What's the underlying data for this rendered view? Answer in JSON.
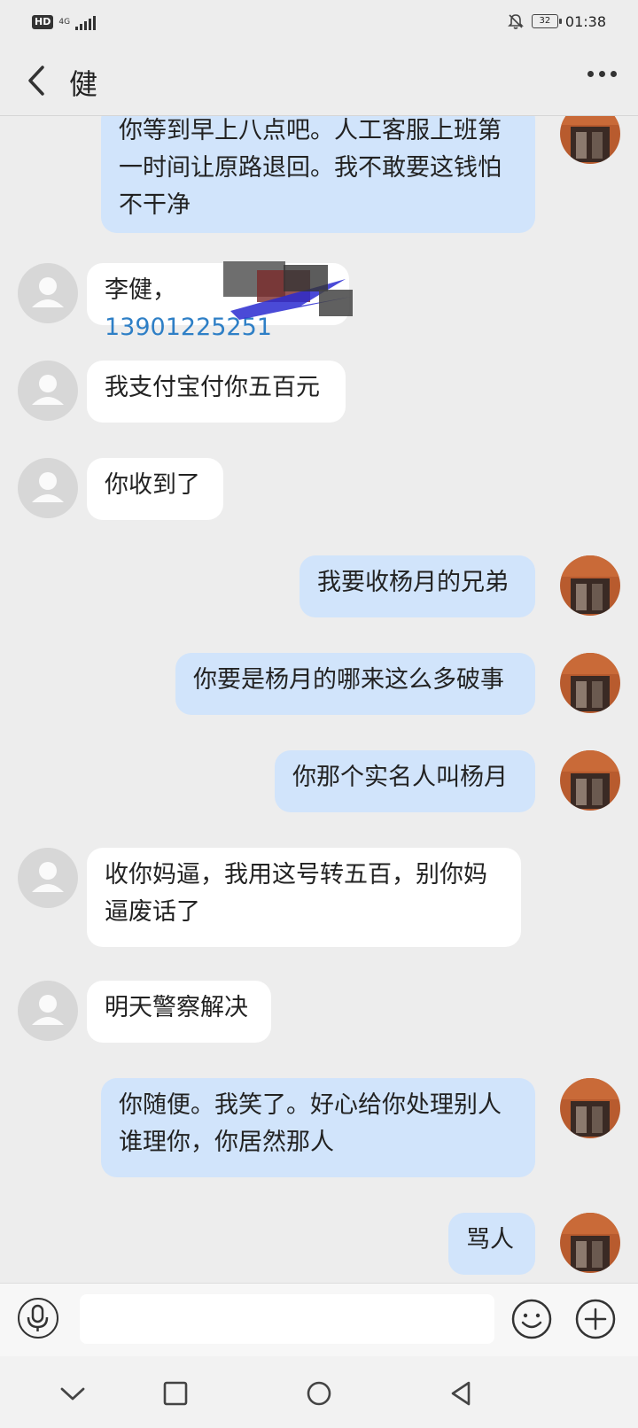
{
  "status_bar": {
    "hd_badge": "HD",
    "network": "4G",
    "battery_level": "32",
    "time": "01:38"
  },
  "header": {
    "contact_name": "健",
    "back_icon": "chevron-left-icon",
    "more_icon": "more-horizontal-icon"
  },
  "messages": [
    {
      "side": "out",
      "text": "你等到早上八点吧。人工客服上班第一时间让原路退回。我不敢要这钱怕不干净"
    },
    {
      "side": "in",
      "prefix": "李健，",
      "phone": "13901225251"
    },
    {
      "side": "in",
      "text": "我支付宝付你五百元"
    },
    {
      "side": "in",
      "text": "你收到了"
    },
    {
      "side": "out",
      "text": "我要收杨月的兄弟"
    },
    {
      "side": "out",
      "text": "你要是杨月的哪来这么多破事"
    },
    {
      "side": "out",
      "text": "你那个实名人叫杨月"
    },
    {
      "side": "in",
      "text": "收你妈逼，我用这号转五百，别你妈逼废话了"
    },
    {
      "side": "in",
      "text": "明天警察解决"
    },
    {
      "side": "out",
      "text": "你随便。我笑了。好心给你处理别人谁理你，你居然那人"
    },
    {
      "side": "out",
      "text": "骂人"
    }
  ],
  "input_bar": {
    "voice_icon": "microphone-icon",
    "text_value": "",
    "emoji_icon": "smiley-icon",
    "plus_icon": "plus-icon"
  },
  "nav_bar": {
    "icons": [
      "chevron-down-icon",
      "square-icon",
      "circle-icon",
      "triangle-back-icon"
    ]
  }
}
